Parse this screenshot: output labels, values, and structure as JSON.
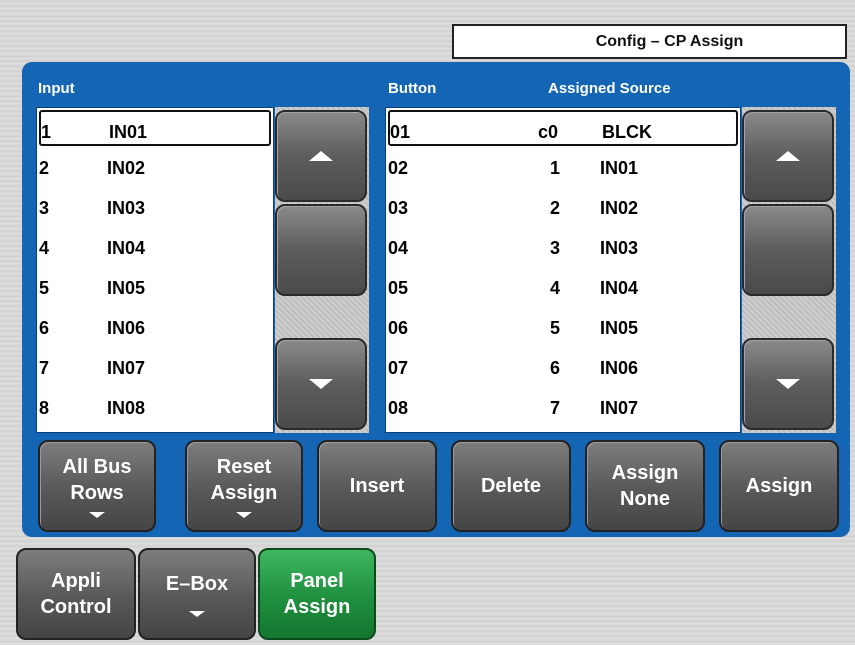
{
  "title": "Config – CP Assign",
  "headers": {
    "input": "Input",
    "button": "Button",
    "assigned_source": "Assigned Source"
  },
  "input_list": [
    {
      "num": "1",
      "name": "IN01"
    },
    {
      "num": "2",
      "name": "IN02"
    },
    {
      "num": "3",
      "name": "IN03"
    },
    {
      "num": "4",
      "name": "IN04"
    },
    {
      "num": "5",
      "name": "IN05"
    },
    {
      "num": "6",
      "name": "IN06"
    },
    {
      "num": "7",
      "name": "IN07"
    },
    {
      "num": "8",
      "name": "IN08"
    }
  ],
  "assign_list": [
    {
      "button": "01",
      "src": "c0",
      "name": "BLCK"
    },
    {
      "button": "02",
      "src": "1",
      "name": "IN01"
    },
    {
      "button": "03",
      "src": "2",
      "name": "IN02"
    },
    {
      "button": "04",
      "src": "3",
      "name": "IN03"
    },
    {
      "button": "05",
      "src": "4",
      "name": "IN04"
    },
    {
      "button": "06",
      "src": "5",
      "name": "IN05"
    },
    {
      "button": "07",
      "src": "6",
      "name": "IN06"
    },
    {
      "button": "08",
      "src": "7",
      "name": "IN07"
    }
  ],
  "actions": {
    "all_bus_rows": [
      "All Bus",
      "Rows"
    ],
    "reset_assign": [
      "Reset",
      "Assign"
    ],
    "insert": "Insert",
    "delete": "Delete",
    "assign_none": [
      "Assign",
      "None"
    ],
    "assign": "Assign"
  },
  "tabs": {
    "appli_control": [
      "Appli",
      "Control"
    ],
    "e_box": "E–Box",
    "panel_assign": [
      "Panel",
      "Assign"
    ]
  },
  "colors": {
    "panel": "#1565b5",
    "active_tab": "#1f8f3e"
  }
}
